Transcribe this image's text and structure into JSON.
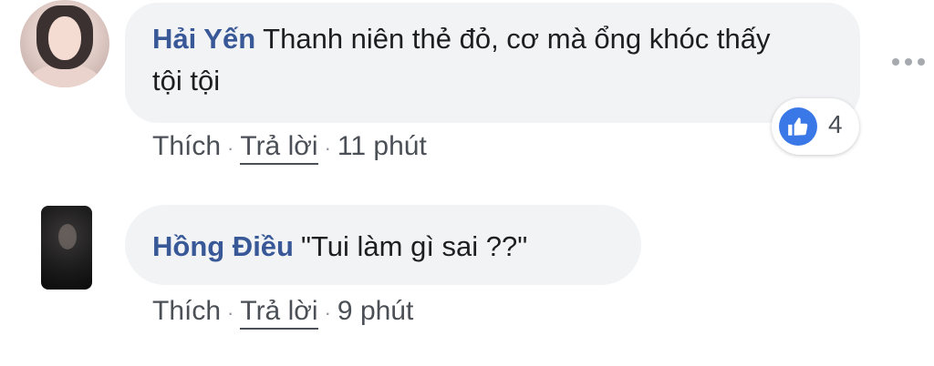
{
  "comments": [
    {
      "author": "Hải Yến",
      "text": "Thanh niên thẻ đỏ, cơ mà ổng khóc thấy tội tội",
      "like_label": "Thích",
      "reply_label": "Trả lời",
      "time": "11 phút",
      "reaction_icon": "like-icon",
      "reaction_count": "4",
      "more_icon": "more-icon"
    },
    {
      "author": "Hồng Điều",
      "text": "\"Tui làm gì sai ??\"",
      "like_label": "Thích",
      "reply_label": "Trả lời",
      "time": "9 phút"
    }
  ],
  "colors": {
    "author": "#385898",
    "bubble": "#f2f3f5",
    "like_blue": "#3b78e7",
    "meta_text": "#4b4f56"
  }
}
